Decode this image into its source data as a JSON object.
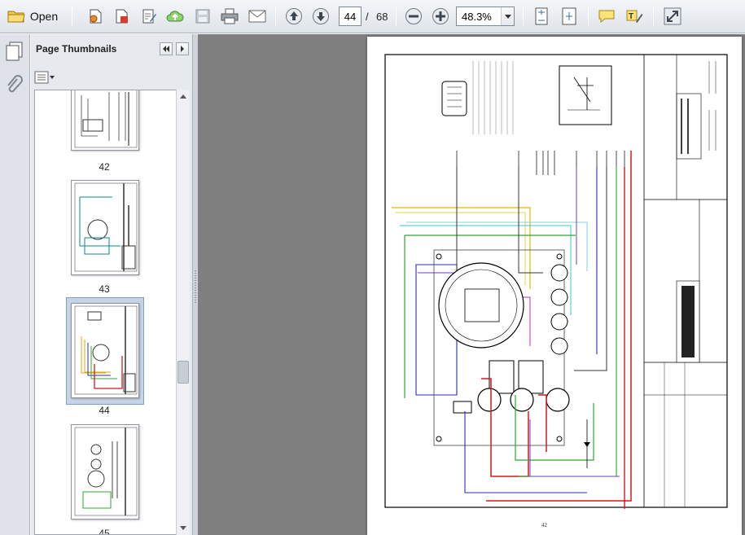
{
  "toolbar": {
    "open_label": "Open",
    "current_page": "44",
    "page_separator": "/",
    "total_pages": "68",
    "zoom": "48.3%"
  },
  "sidebar": {
    "panel_title": "Page Thumbnails",
    "thumbnails": [
      {
        "label": "42"
      },
      {
        "label": "43"
      },
      {
        "label": "44",
        "selected": true
      },
      {
        "label": "45"
      }
    ]
  },
  "document": {
    "page_footer_number": "42"
  },
  "colors": {
    "toolbar_bg": "#e6eaef",
    "document_bg": "#7f7f7f",
    "selection": "#c5d4e6"
  }
}
